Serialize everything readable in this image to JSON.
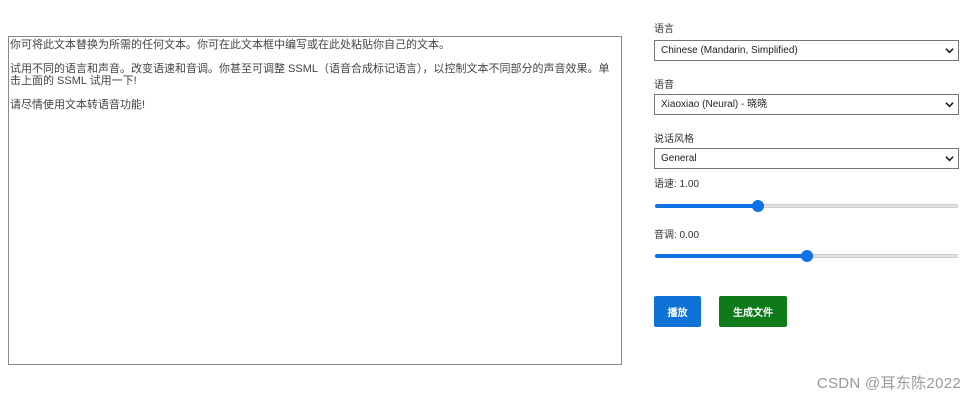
{
  "editor": {
    "text": "你可将此文本替换为所需的任何文本。你可在此文本框中编写或在此处粘贴你自己的文本。\n\n试用不同的语言和声音。改变语速和音调。你甚至可调整 SSML（语音合成标记语言），以控制文本不同部分的声音效果。单击上面的 SSML 试用一下!\n\n请尽情使用文本转语音功能!"
  },
  "language": {
    "label": "语言",
    "selected": "Chinese (Mandarin, Simplified)"
  },
  "voice": {
    "label": "语音",
    "selected": "Xiaoxiao (Neural) - 晓晓"
  },
  "style": {
    "label": "说话风格",
    "selected": "General"
  },
  "rate": {
    "label": "语速: 1.00",
    "fraction": 0.34
  },
  "pitch": {
    "label": "音调: 0.00",
    "fraction": 0.5
  },
  "buttons": {
    "play_label": "播放",
    "generate_label": "生成文件"
  },
  "colors": {
    "accent": "#0f72e5",
    "play_button": "#0f72d6",
    "generate_button": "#0f7a19"
  },
  "icons": {
    "dropdown": "chevron-down-icon"
  },
  "watermark": "CSDN @耳东陈2022"
}
